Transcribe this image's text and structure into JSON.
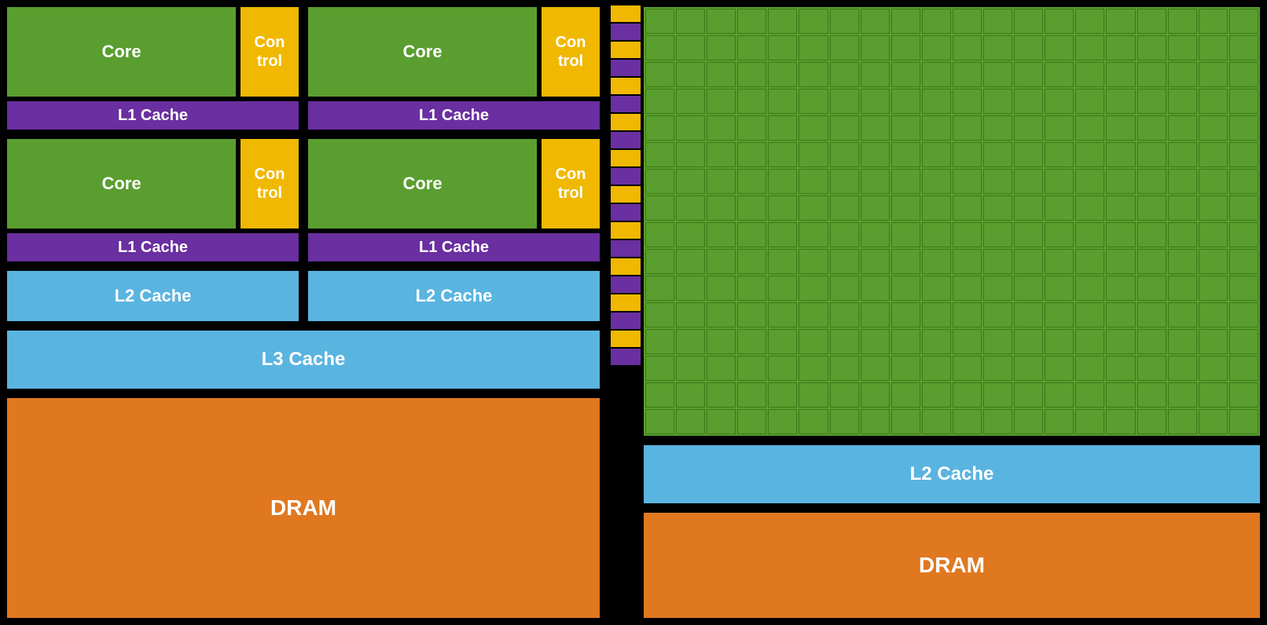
{
  "left": {
    "row1": {
      "group1": {
        "core_label": "Core",
        "control_label": "Con\ntrol",
        "l1_label": "L1 Cache"
      },
      "group2": {
        "core_label": "Core",
        "control_label": "Con\ntrol",
        "l1_label": "L1 Cache"
      }
    },
    "row2": {
      "group1": {
        "core_label": "Core",
        "control_label": "Con\ntrol",
        "l1_label": "L1 Cache"
      },
      "group2": {
        "core_label": "Core",
        "control_label": "Con\ntrol",
        "l1_label": "L1 Cache"
      }
    },
    "l2_left": "L2 Cache",
    "l2_right": "L2 Cache",
    "l3": "L3 Cache",
    "dram": "DRAM"
  },
  "right": {
    "l2": "L2 Cache",
    "dram": "DRAM",
    "grid_cols": 20,
    "grid_rows": 16,
    "stripe_segments": 20
  },
  "colors": {
    "green": "#5a9e2f",
    "yellow": "#f0b800",
    "purple": "#6a2fa0",
    "blue": "#5ab4e0",
    "orange": "#e07820",
    "black": "#000000"
  }
}
